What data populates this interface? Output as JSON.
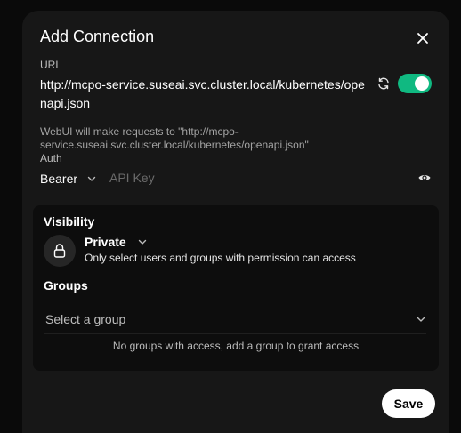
{
  "dialog": {
    "title": "Add Connection",
    "close_icon": "close-icon"
  },
  "url": {
    "label": "URL",
    "value": "http://mcpo-service.suseai.svc.cluster.local/kubernetes/openapi.json",
    "refresh_icon": "refresh-icon",
    "enabled": true,
    "toggle_color": "#10b981",
    "hint": "WebUI will make requests to \"http://mcpo-service.suseai.svc.cluster.local/kubernetes/openapi.json\""
  },
  "auth": {
    "label": "Auth",
    "type_value": "Bearer",
    "key_placeholder": "API Key",
    "key_value": "",
    "visibility_icon": "eye-icon"
  },
  "visibility": {
    "title": "Visibility",
    "icon": "lock-icon",
    "value": "Private",
    "description": "Only select users and groups with permission can access"
  },
  "groups": {
    "title": "Groups",
    "placeholder": "Select a group",
    "empty_message": "No groups with access, add a group to grant access"
  },
  "actions": {
    "save_label": "Save"
  }
}
